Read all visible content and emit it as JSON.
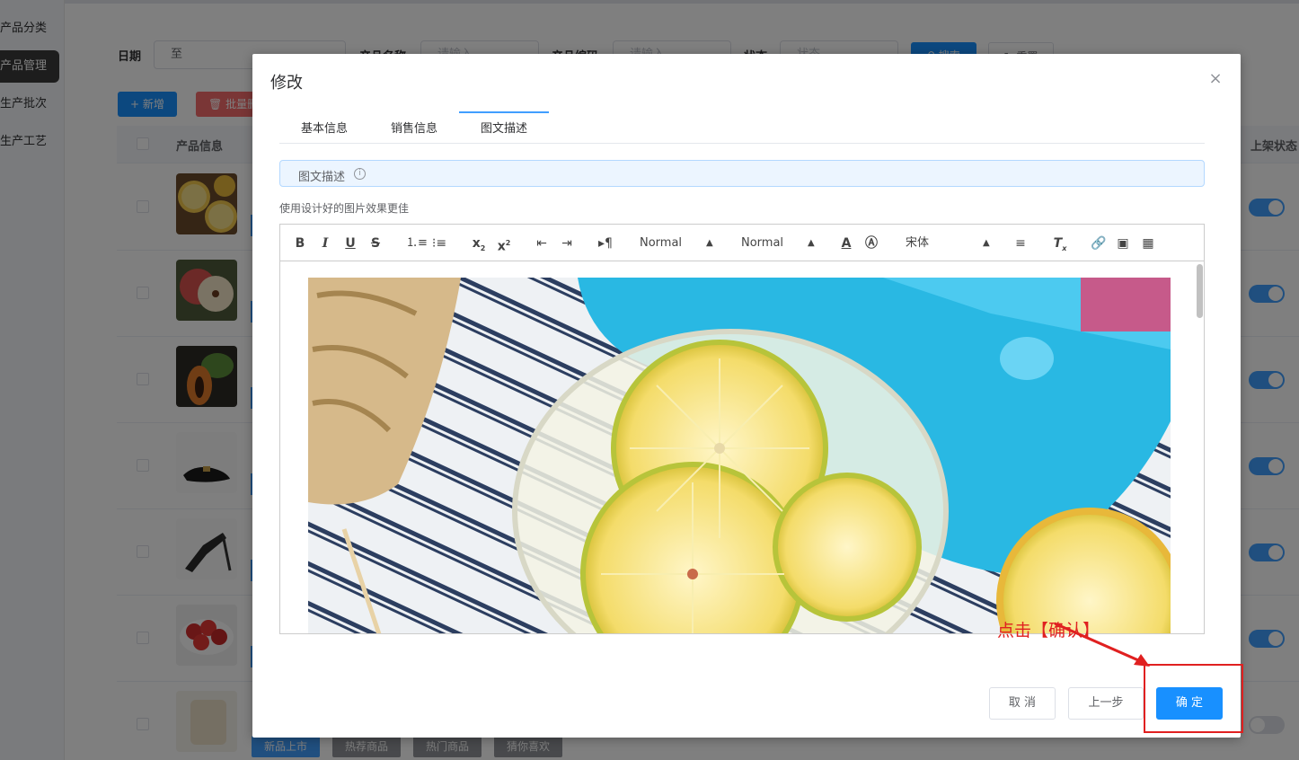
{
  "sidebar": {
    "items": [
      {
        "label": "产品分类",
        "active": false
      },
      {
        "label": "产品管理",
        "active": true
      },
      {
        "label": "生产批次",
        "active": false
      },
      {
        "label": "生产工艺",
        "active": false
      }
    ]
  },
  "filters": {
    "date_label": "日期",
    "date_range_separator": "至",
    "product_name_label": "产品名称",
    "product_name_placeholder": "请输入",
    "product_code_label": "产品编码",
    "product_code_placeholder": "请输入",
    "status_label": "状态",
    "status_placeholder": "状态",
    "search_label": "搜索",
    "reset_label": "重置"
  },
  "actions": {
    "add_label": "+ 新增",
    "batch_delete_label": "批量删除"
  },
  "table": {
    "columns": {
      "product_info": "产品信息",
      "listing_status": "上架状态"
    },
    "rows": [
      {
        "image": "lemon",
        "listed": true
      },
      {
        "image": "apple",
        "listed": true
      },
      {
        "image": "papaya",
        "listed": true
      },
      {
        "image": "black-slipper",
        "listed": true
      },
      {
        "image": "sandal",
        "listed": true
      },
      {
        "image": "strawberry",
        "listed": true
      },
      {
        "image": "roll",
        "listed": false
      }
    ],
    "tag_buttons": [
      "新品上市",
      "热荐商品",
      "热门商品",
      "猜你喜欢"
    ]
  },
  "dialog": {
    "title": "修改",
    "tabs": [
      {
        "label": "基本信息",
        "active": false
      },
      {
        "label": "销售信息",
        "active": false
      },
      {
        "label": "图文描述",
        "active": true
      }
    ],
    "section_title": "图文描述",
    "hint": "使用设计好的图片效果更佳",
    "editor": {
      "header_select": "Normal",
      "size_select": "Normal",
      "font_select": "宋体",
      "image_alt": "lemon slices in a glass"
    },
    "annotation": "点击【确认】",
    "buttons": {
      "cancel": "取 消",
      "prev": "上一步",
      "confirm": "确 定"
    }
  },
  "colors": {
    "primary": "#1890ff",
    "danger": "#f56c6c",
    "annotation_red": "#e02020",
    "tag_blue": "#409eff",
    "tag_gray": "#909399"
  }
}
